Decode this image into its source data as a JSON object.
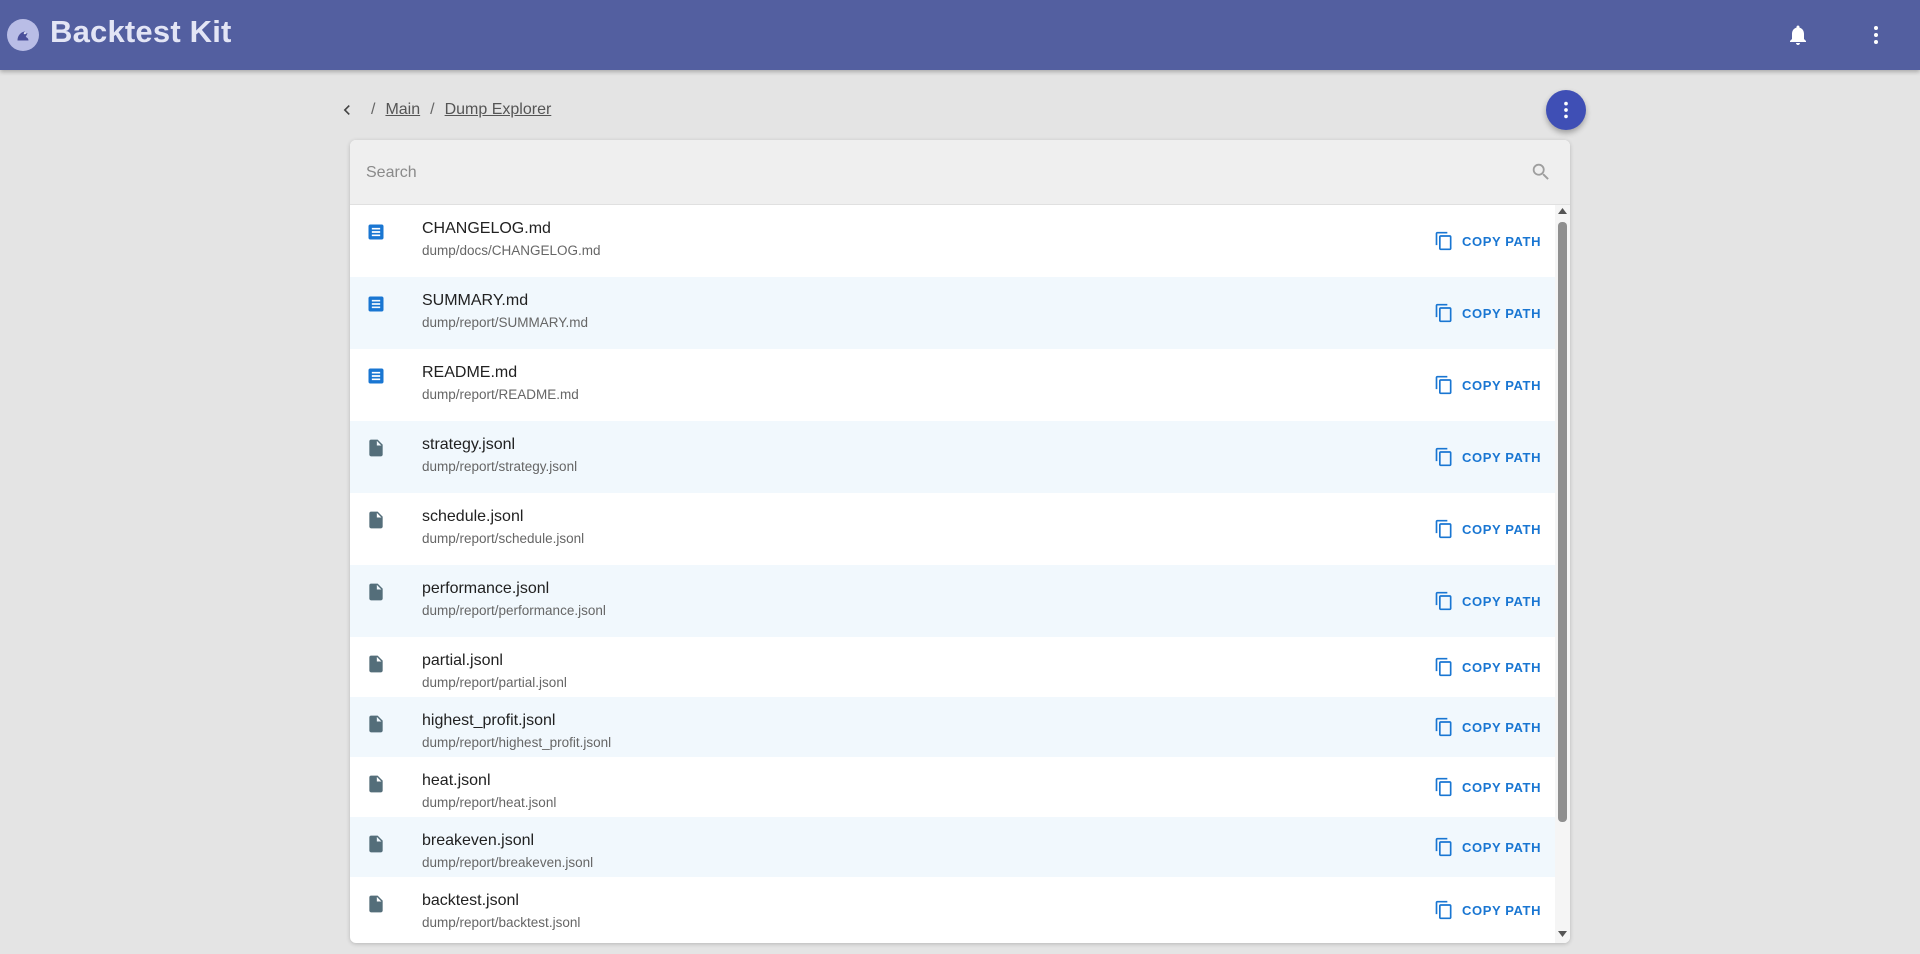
{
  "app": {
    "title": "Backtest Kit",
    "accent": "#535fa0"
  },
  "breadcrumb": {
    "sep1": "/",
    "main": "Main",
    "sep2": "/",
    "current": "Dump Explorer"
  },
  "search": {
    "placeholder": "Search",
    "value": ""
  },
  "files": [
    {
      "name": "CHANGELOG.md",
      "path": "dump/docs/CHANGELOG.md",
      "type": "document-icon",
      "action": "COPY PATH"
    },
    {
      "name": "SUMMARY.md",
      "path": "dump/report/SUMMARY.md",
      "type": "document-icon",
      "action": "COPY PATH"
    },
    {
      "name": "README.md",
      "path": "dump/report/README.md",
      "type": "document-icon",
      "action": "COPY PATH"
    },
    {
      "name": "strategy.jsonl",
      "path": "dump/report/strategy.jsonl",
      "type": "file-icon",
      "action": "COPY PATH"
    },
    {
      "name": "schedule.jsonl",
      "path": "dump/report/schedule.jsonl",
      "type": "file-icon",
      "action": "COPY PATH"
    },
    {
      "name": "performance.jsonl",
      "path": "dump/report/performance.jsonl",
      "type": "file-icon",
      "action": "COPY PATH"
    },
    {
      "name": "partial.jsonl",
      "path": "dump/report/partial.jsonl",
      "type": "file-icon",
      "action": "COPY PATH"
    },
    {
      "name": "highest_profit.jsonl",
      "path": "dump/report/highest_profit.jsonl",
      "type": "file-icon",
      "action": "COPY PATH"
    },
    {
      "name": "heat.jsonl",
      "path": "dump/report/heat.jsonl",
      "type": "file-icon",
      "action": "COPY PATH"
    },
    {
      "name": "breakeven.jsonl",
      "path": "dump/report/breakeven.jsonl",
      "type": "file-icon",
      "action": "COPY PATH"
    },
    {
      "name": "backtest.jsonl",
      "path": "dump/report/backtest.jsonl",
      "type": "file-icon",
      "action": "COPY PATH"
    }
  ],
  "colors": {
    "doc_icon": "#1976d2",
    "file_icon": "#546e7a",
    "action": "#1976d2",
    "row_alt": "#f1f8fd"
  }
}
